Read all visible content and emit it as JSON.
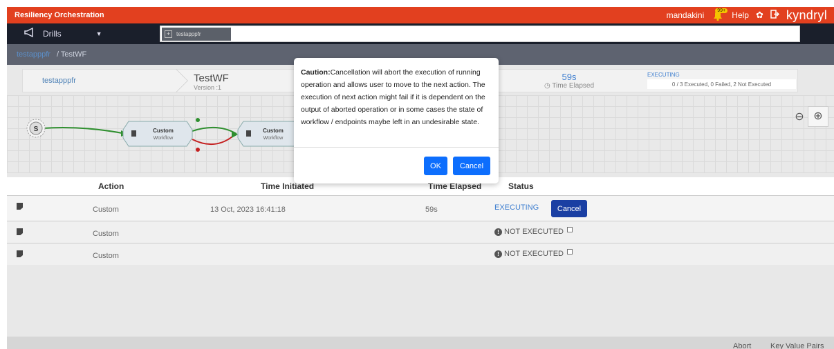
{
  "header": {
    "app_title": "Resiliency Orchestration",
    "user": "mandakini",
    "notification_badge": "99+",
    "help": "Help",
    "brand": "kyndryl"
  },
  "nav": {
    "menu": "Drills",
    "tab": "testapppfr"
  },
  "breadcrumb": {
    "parent": "testapppfr",
    "current": "/ TestWF"
  },
  "summary": {
    "app": "testapppfr",
    "workflow": "TestWF",
    "version": "Version :1",
    "elapsed": "59s",
    "elapsed_label": "Time Elapsed",
    "state": "EXECUTING",
    "progress": "0 / 3 Executed, 0 Failed, 2 Not Executed"
  },
  "diagram": {
    "start": "S",
    "node1_title": "Custom",
    "node1_sub": "Workflow",
    "node2_title": "Custom",
    "node2_sub": "Workflow"
  },
  "table": {
    "headers": [
      "Action",
      "Time Initiated",
      "Time Elapsed",
      "Status"
    ],
    "rows": [
      {
        "action": "Custom",
        "time": "13 Oct, 2023 16:41:18",
        "elapsed": "59s",
        "status": "EXECUTING",
        "button": "Cancel"
      },
      {
        "action": "Custom",
        "time": "",
        "elapsed": "",
        "status": "NOT EXECUTED"
      },
      {
        "action": "Custom",
        "time": "",
        "elapsed": "",
        "status": "NOT EXECUTED"
      }
    ]
  },
  "footer": {
    "abort": "Abort",
    "kv": "Key Value Pairs"
  },
  "dialog": {
    "caution": "Caution:",
    "message": "Cancellation will abort the execution of running operation and allows user to move to the next action. The execution of next action might fail if it is dependent on the output of aborted operation or in some cases the state of workflow / endpoints maybe left in an undesirable state.",
    "ok": "OK",
    "cancel": "Cancel"
  },
  "colors": {
    "topbar": "#e2401f",
    "navbar": "#1a1f2b",
    "primary": "#0d6efd",
    "link": "#3f7fd0"
  }
}
